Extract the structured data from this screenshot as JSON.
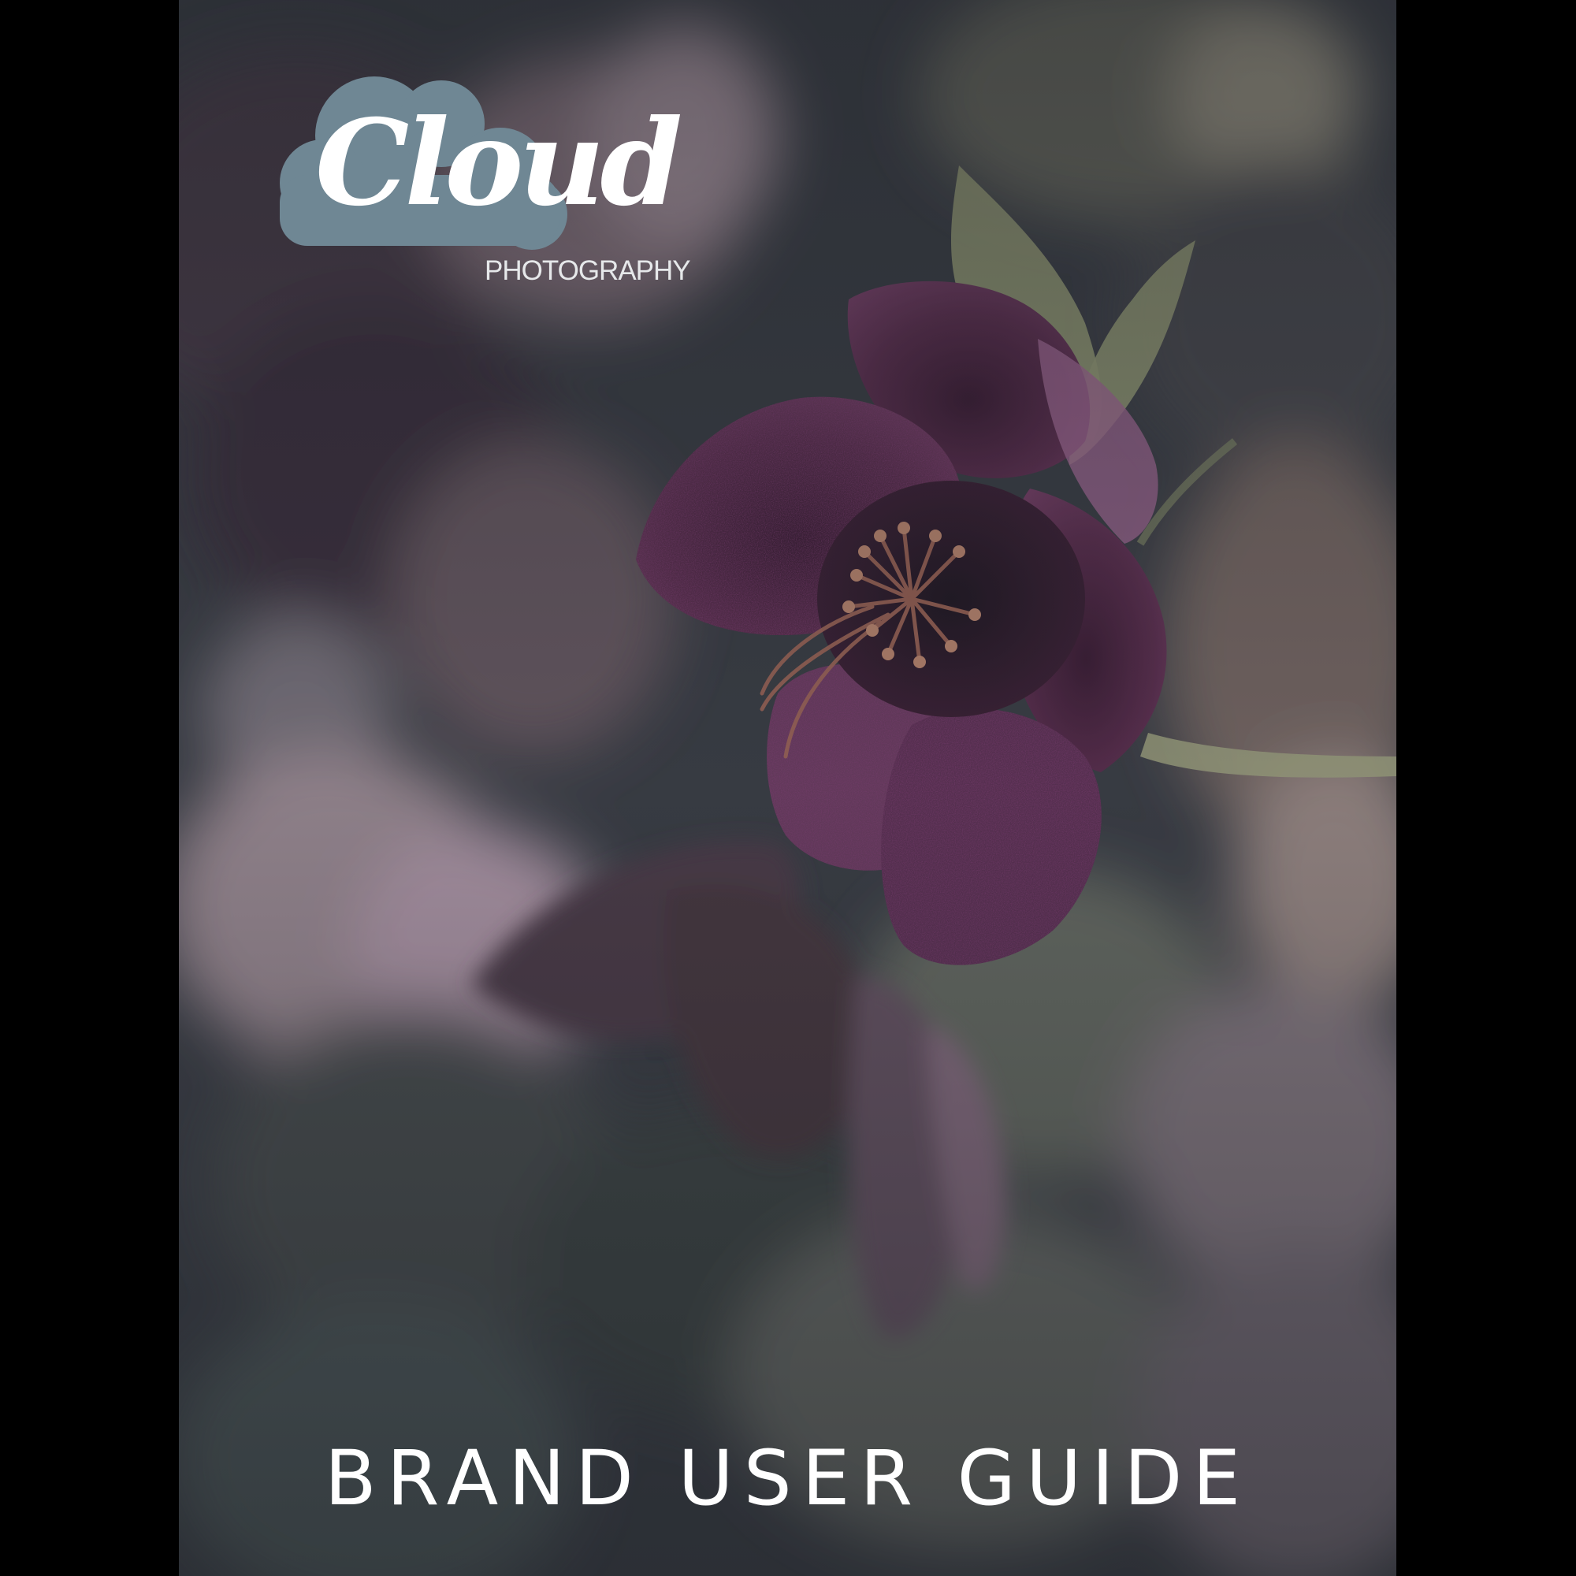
{
  "document": {
    "type": "brand guide cover",
    "background_color": "#000000",
    "overlay_tint": "#2f3338"
  },
  "logo": {
    "wordmark": "Cloud",
    "subtitle": "PHOTOGRAPHY",
    "cloud_color": "#6f8794",
    "text_color": "#ffffff"
  },
  "cover": {
    "title": "BRAND USER GUIDE",
    "title_color": "#ffffff"
  },
  "photo": {
    "subject": "purple hellebore flower",
    "flower_color": "#5a2a4a",
    "stamen_color": "#a86a5a",
    "leaf_color": "#9aa07a"
  }
}
